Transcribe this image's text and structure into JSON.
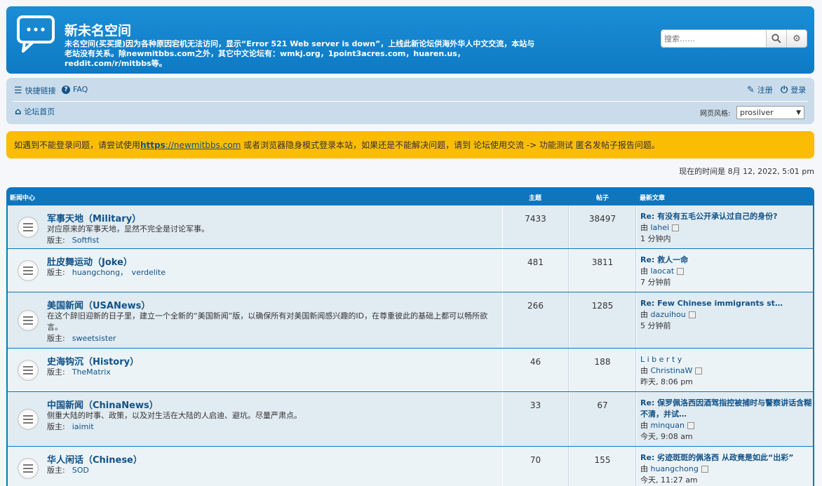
{
  "header": {
    "title": "新未名空间",
    "description": "未名空间(买买提)因为各种原因宕机无法访问，显示“Error 521 Web server is down”，上线此新论坛供海外华人中文交流，本站与老站没有关系。除newmitbbs.com之外，其它中文论坛有：wmkj.org，1point3acres.com，huaren.us，reddit.com/r/mitbbs等。",
    "search_placeholder": "搜索……",
    "search_icon": "search-icon",
    "advanced_icon": "gear-icon"
  },
  "nav": {
    "quick_links": "快捷链接",
    "faq": "FAQ",
    "register": "注册",
    "login": "登录",
    "home": "论坛首页",
    "style_label": "网页风格:",
    "style_value": "prosilver"
  },
  "notice": {
    "before": "如遇到不能登录问题，请尝试使用",
    "link_bold": "https",
    "link_rest": "://newmitbbs.com",
    "after": " 或者浏览器隐身模式登录本站，如果还是不能解决问题，请到 论坛使用交流 -> 功能测试 匿名发帖子报告问题。"
  },
  "current_time": "现在的时间是 8月 12, 2022, 5:01 pm",
  "forum": {
    "header": {
      "name": "新闻中心",
      "topics": "主题",
      "posts": "帖子",
      "last_post": "最新文章"
    },
    "moderator_label": "版主:",
    "by_label": "由",
    "rows": [
      {
        "title": "军事天地（Military）",
        "desc": "对应原来的军事天地，显然不完全是讨论军事。",
        "mods": "Softfist",
        "topics": "7433",
        "posts": "38497",
        "last_title": "Re: 有没有五毛公开承认过自己的身份?",
        "last_by": "lahei",
        "last_time": "1 分钟内"
      },
      {
        "title": "肚皮舞运动（Joke）",
        "desc": "",
        "mods": "huangchong，　verdelite",
        "topics": "481",
        "posts": "3811",
        "last_title": "Re: 救人一命",
        "last_by": "laocat",
        "last_time": "7 分钟前"
      },
      {
        "title": "美国新闻（USANews）",
        "desc": "在这个辞旧迎新的日子里，建立一个全新的“美国新闻”版，以确保所有对美国新闻感兴趣的ID，在尊重彼此的基础上都可以畅所欲言。",
        "mods": "sweetsister",
        "topics": "266",
        "posts": "1285",
        "last_title": "Re: Few Chinese immigrants st…",
        "last_by": "dazuihou",
        "last_time": "5 分钟前"
      },
      {
        "title": "史海钩沉（History）",
        "desc": "",
        "mods": "TheMatrix",
        "topics": "46",
        "posts": "188",
        "last_title": "L i b e r t y",
        "last_by": "ChristinaW",
        "last_time": "昨天, 8:06 pm"
      },
      {
        "title": "中国新闻（ChinaNews）",
        "desc": "侧重大陆的时事、政策，以及对生活在大陆的人启迪、避坑。尽量严肃点。",
        "mods": "iaimit",
        "topics": "33",
        "posts": "67",
        "last_title": "Re: 保罗佩洛西因酒驾指控被捕时与警察讲话含糊不清，并试…",
        "last_by": "minquan",
        "last_time": "今天, 9:08 am"
      },
      {
        "title": "华人闲话（Chinese）",
        "desc": "",
        "mods": "SOD",
        "topics": "70",
        "posts": "155",
        "last_title": "Re: 劣迹斑斑的佩洛西 从政竟是如此“出彩”",
        "last_by": "huangchong",
        "last_time": "今天, 11:27 am"
      }
    ]
  }
}
